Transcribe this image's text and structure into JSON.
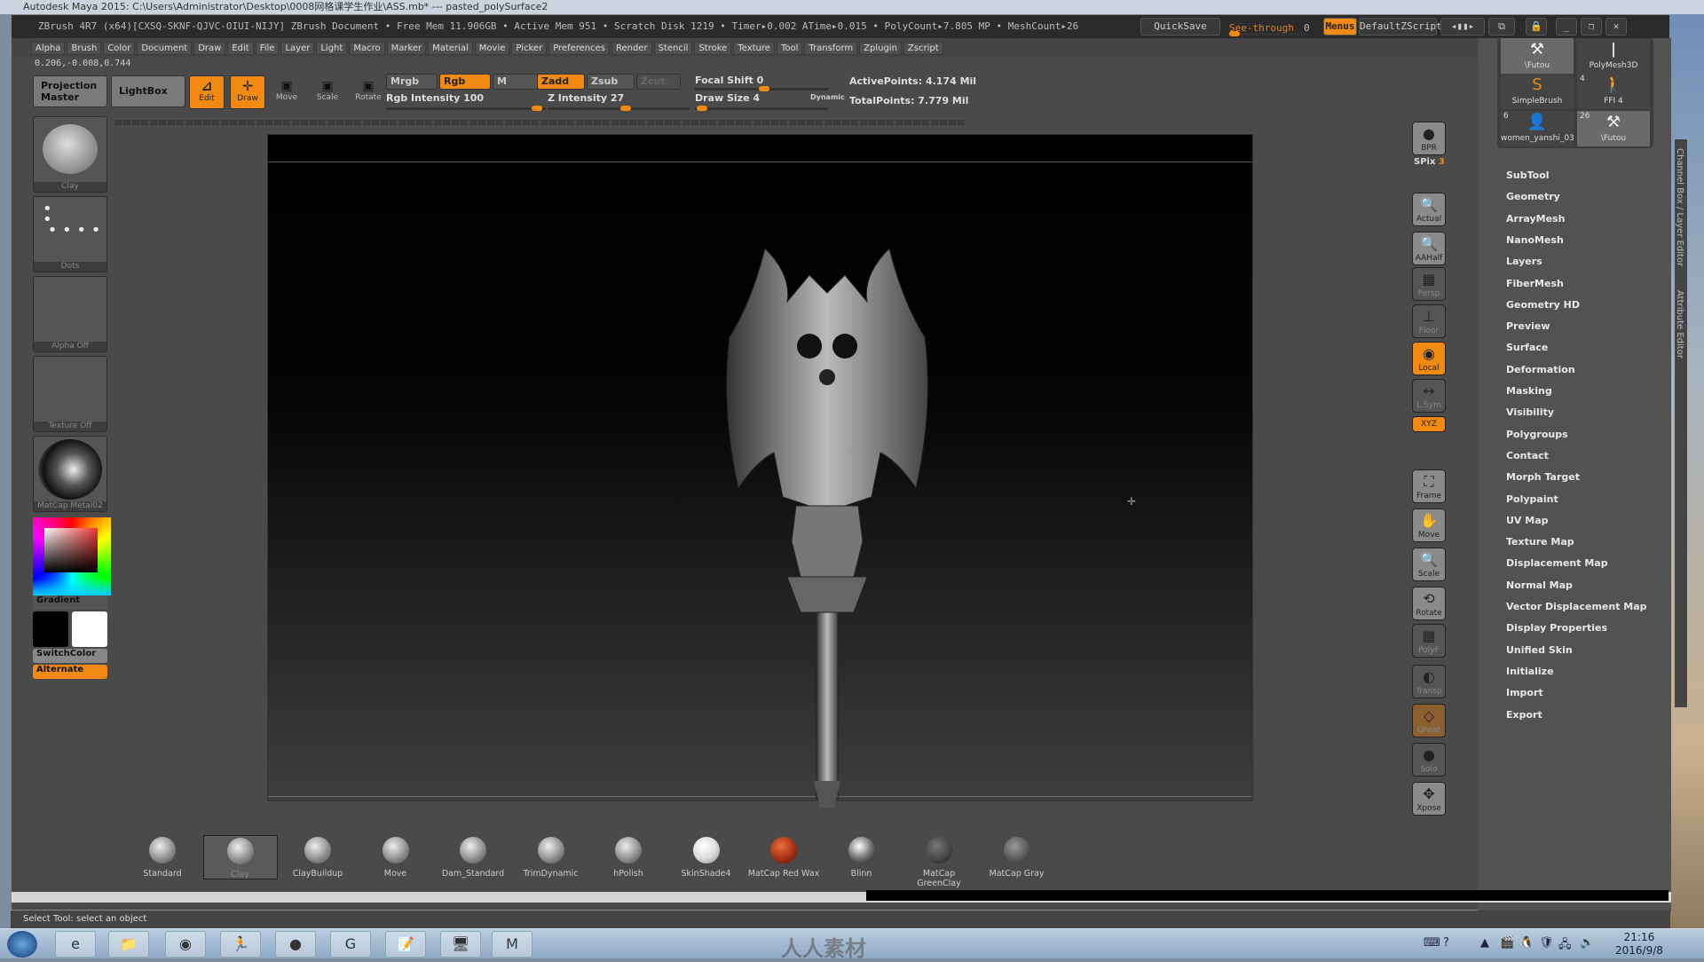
{
  "maya": {
    "title": "Autodesk Maya 2015: C:\\Users\\Administrator\\Desktop\\0008网格课学生作业\\ASS.mb*  ---  pasted_polySurface2"
  },
  "zbrush": {
    "title": "ZBrush 4R7 (x64)[CXSQ-SKNF-QJVC-OIUI-NIJY]    ZBrush Document      • Free Mem 11.906GB • Active Mem 951 • Scratch Disk 1219 •  Timer▸0.002 ATime▸0.015 • PolyCount▸7.805 MP  • MeshCount▸26",
    "quicksave": "QuickSave",
    "see_through_label": "See-through",
    "see_through_value": "0",
    "menus": "Menus",
    "default_zscript": "DefaultZScript",
    "menus_list": [
      "Alpha",
      "Brush",
      "Color",
      "Document",
      "Draw",
      "Edit",
      "File",
      "Layer",
      "Light",
      "Macro",
      "Marker",
      "Material",
      "Movie",
      "Picker",
      "Preferences",
      "Render",
      "Stencil",
      "Stroke",
      "Texture",
      "Tool",
      "Transform",
      "Zplugin",
      "Zscript"
    ],
    "coords": "0.206,-0.008,0.744",
    "shelf": {
      "projection_master": "Projection Master",
      "lightbox": "LightBox",
      "edit": "Edit",
      "draw": "Draw",
      "move": "Move",
      "scale": "Scale",
      "rotate": "Rotate",
      "mrgb": "Mrgb",
      "rgb": "Rgb",
      "m": "M",
      "zadd": "Zadd",
      "zsub": "Zsub",
      "zcut": "Zcut",
      "rgb_intensity_label": "Rgb Intensity",
      "rgb_intensity": "100",
      "z_intensity_label": "Z Intensity",
      "z_intensity": "27",
      "focal_shift_label": "Focal Shift",
      "focal_shift": "0",
      "draw_size_label": "Draw Size",
      "draw_size": "4",
      "dynamic": "Dynamic",
      "active_points": "ActivePoints: 4.174 Mil",
      "total_points": "TotalPoints: 7.779 Mil"
    },
    "left": {
      "brush": "Clay",
      "stroke": "Dots",
      "alpha": "Alpha Off",
      "texture": "Texture Off",
      "material": "MatCap Metal02",
      "gradient": "Gradient",
      "switch_color": "SwitchColor",
      "alternate": "Alternate"
    },
    "right_shelf": [
      "BPR",
      "Actual",
      "AAHalf",
      "Persp",
      "Floor",
      "Local",
      "L.Sym",
      "XYZ",
      "Frame",
      "Move",
      "Scale",
      "Rotate",
      "PolyF",
      "Transp",
      "Ghost",
      "Solo",
      "Xpose"
    ],
    "spix_label": "SPix",
    "spix": "3",
    "tool_thumbs": [
      {
        "name": "\\Futou"
      },
      {
        "name": "PolyMesh3D"
      },
      {
        "name": "SimpleBrush"
      },
      {
        "name": "FFI 4",
        "count": "4"
      },
      {
        "name": "women_yanshi_03",
        "count": "6"
      },
      {
        "name": "\\Futou",
        "count": "26"
      }
    ],
    "tool_menu": [
      "SubTool",
      "Geometry",
      "ArrayMesh",
      "NanoMesh",
      "Layers",
      "FiberMesh",
      "Geometry HD",
      "Preview",
      "Surface",
      "Deformation",
      "Masking",
      "Visibility",
      "Polygroups",
      "Contact",
      "Morph Target",
      "Polypaint",
      "UV Map",
      "Texture Map",
      "Displacement Map",
      "Normal Map",
      "Vector Displacement Map",
      "Display Properties",
      "Unified Skin",
      "Initialize",
      "Import",
      "Export"
    ],
    "side_tabs": [
      "Channel Box / Layer Editor",
      "Attribute Editor"
    ],
    "bottom_shelf": [
      "Standard",
      "Clay",
      "ClayBuildup",
      "Move",
      "Dam_Standard",
      "TrimDynamic",
      "hPolish",
      "SkinShade4",
      "MatCap Red Wax",
      "Blinn",
      "MatCap GreenClay",
      "MatCap Gray"
    ]
  },
  "status": "Select Tool: select an object",
  "taskbar": {
    "time": "21:16",
    "date": "2016/9/8"
  },
  "watermark": "人人素材",
  "colors": {
    "accent": "#f08a12",
    "panel": "#4a4a4a"
  }
}
